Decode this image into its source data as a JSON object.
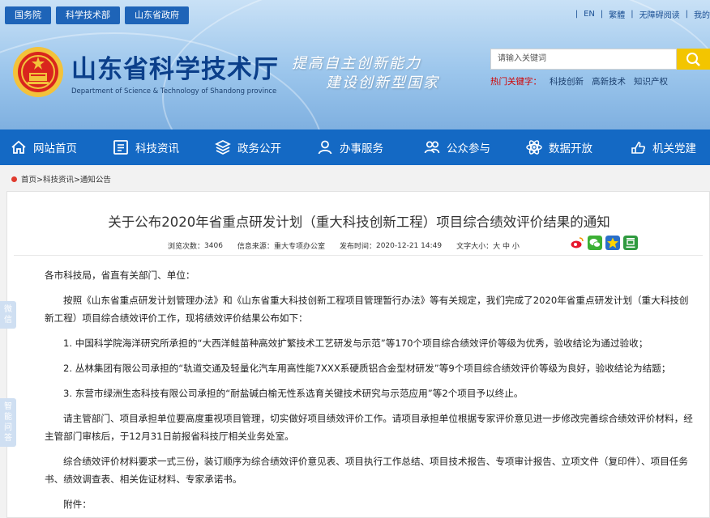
{
  "top_tabs": [
    "国务院",
    "科学技术部",
    "山东省政府"
  ],
  "top_links": [
    "EN",
    "繁體",
    "无障碍阅读",
    "我的"
  ],
  "site": {
    "title": "山东省科学技术厅",
    "subtitle": "Department of Science & Technology of Shandong province",
    "slogan_line1": "提高自主创新能力",
    "slogan_line2": "建设创新型国家"
  },
  "search": {
    "placeholder": "请输入关键词",
    "hot_label": "热门关键字：",
    "hot_words": [
      "科技创新",
      "高新技术",
      "知识产权"
    ]
  },
  "nav": [
    {
      "label": "网站首页",
      "icon": "home-icon"
    },
    {
      "label": "科技资讯",
      "icon": "news-icon"
    },
    {
      "label": "政务公开",
      "icon": "layers-icon"
    },
    {
      "label": "办事服务",
      "icon": "user-service-icon"
    },
    {
      "label": "公众参与",
      "icon": "people-icon"
    },
    {
      "label": "数据开放",
      "icon": "atom-icon"
    },
    {
      "label": "机关党建",
      "icon": "hand-icon"
    }
  ],
  "breadcrumb": "首页>科技资讯>通知公告",
  "article": {
    "title": "关于公布2020年省重点研发计划（重大科技创新工程）项目综合绩效评价结果的通知",
    "meta": {
      "views_label": "浏览次数：",
      "views": "3406",
      "source_label": "信息来源：",
      "source": "重大专项办公室",
      "time_label": "发布时间：",
      "time": "2020-12-21 14:49",
      "fontsize_label": "文字大小：",
      "fontsize_options": "大 中 小"
    },
    "share_icons": [
      "weibo-icon",
      "wechat-icon",
      "star-icon",
      "douban-icon"
    ],
    "paragraphs": [
      "各市科技局，省直有关部门、单位：",
      "按照《山东省重点研发计划管理办法》和《山东省重大科技创新工程项目管理暂行办法》等有关规定，我们完成了2020年省重点研发计划（重大科技创新工程）项目综合绩效评价工作，现将绩效评价结果公布如下：",
      "1. 中国科学院海洋研究所承担的“大西洋鲑苗种高效扩繁技术工艺研发与示范”等170个项目综合绩效评价等级为优秀，验收结论为通过验收；",
      "2. 丛林集团有限公司承担的“轨道交通及轻量化汽车用高性能7XXX系硬质铝合金型材研发”等9个项目综合绩效评价等级为良好，验收结论为结题；",
      "3. 东营市绿洲生态科技有限公司承担的“耐盐碱白榆无性系选育关键技术研究与示范应用”等2个项目予以终止。",
      "请主管部门、项目承担单位要高度重视项目管理，切实做好项目绩效评价工作。请项目承担单位根据专家评价意见进一步修改完善综合绩效评价材料，经主管部门审核后，于12月31日前报省科技厅相关业务处室。",
      "综合绩效评价材料要求一式三份，装订顺序为综合绩效评价意见表、项目执行工作总结、项目技术报告、专项审计报告、立项文件（复印件）、项目任务书、绩效调查表、相关佐证材料、专家承诺书。",
      "附件："
    ]
  },
  "side_tabs": [
    [
      "微",
      "信"
    ],
    [
      "智",
      "能",
      "问",
      "答"
    ]
  ]
}
